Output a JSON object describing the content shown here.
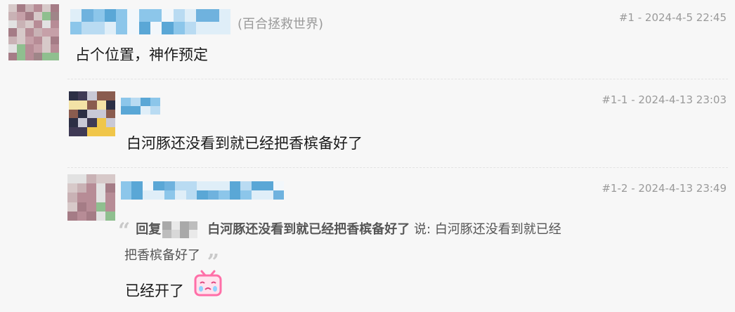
{
  "comments": [
    {
      "floor": "#1",
      "date": "2024-4-5 22:45",
      "separator": " - ",
      "tag": "(百合拯救世界)",
      "text": "占个位置，神作预定"
    },
    {
      "floor": "#1-1",
      "date": "2024-4-13 23:03",
      "separator": " - ",
      "text": "白河豚还没看到就已经把香槟备好了"
    },
    {
      "floor": "#1-2",
      "date": "2024-4-13 23:49",
      "separator": " - ",
      "quote": {
        "reply_prefix": "回复",
        "quoted_bold": "白河豚还没看到就已经把香槟备好了",
        "said": "说:",
        "quoted_line1": "白河豚还没看到就已经",
        "quoted_line2": "把香槟备好了"
      },
      "text": "已经开了",
      "emoji": "crying-tv-emoji"
    }
  ],
  "colors": {
    "background": "#f7f7f7",
    "meta": "#9a9a9a",
    "text": "#1a1a1a",
    "name_blue": "#5aa7d6",
    "emoji_pink": "#ff6fa8"
  }
}
